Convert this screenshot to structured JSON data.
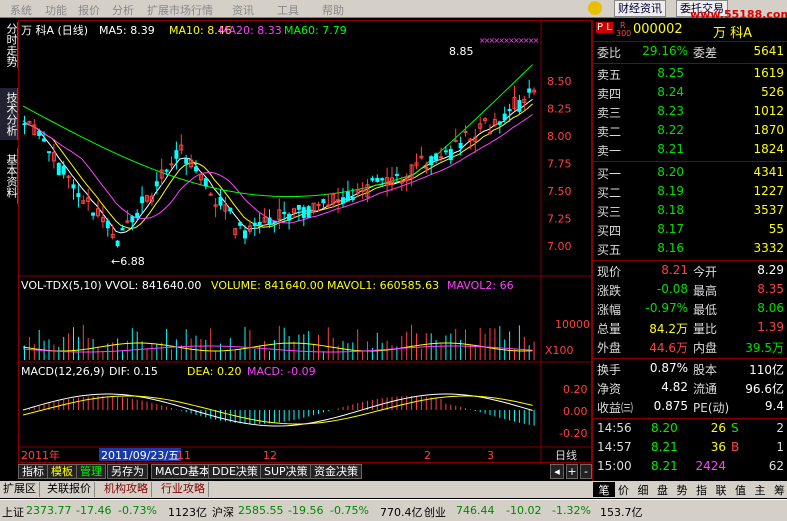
{
  "menu": [
    "系统",
    "功能",
    "报价",
    "分析",
    "扩展市场行情",
    "资讯",
    "工具",
    "帮助"
  ],
  "logos": [
    "财经资讯",
    "委托交易"
  ],
  "watermark": "www.55188.com",
  "side_tabs": [
    "分时走势",
    "技术分析",
    "基本资料"
  ],
  "chart_header": {
    "stock": "万  科A (日线)",
    "ma5": "MA5: 8.39",
    "ma10": "MA10: 8.46",
    "ma20": "MA20: 8.33",
    "ma60": "MA60: 7.79"
  },
  "price_axis": [
    "8.50",
    "8.25",
    "8.00",
    "7.75",
    "7.50",
    "7.25",
    "7.00"
  ],
  "high_label": "8.85",
  "low_label": "←6.88",
  "vol_header": {
    "name": "VOL-TDX(5,10)",
    "vvol": "VVOL: 841640.00",
    "volume": "VOLUME: 841640.00",
    "mavol1": "MAVOL1: 660585.63",
    "mavol2": "MAVOL2: 66"
  },
  "vol_axis": [
    "10000"
  ],
  "vol_unit": "X100",
  "macd_header": {
    "name": "MACD(12,26,9)",
    "dif": "DIF: 0.15",
    "dea": "DEA: 0.20",
    "macd": "MACD: -0.09"
  },
  "macd_axis": [
    "0.20",
    "0.00",
    "-0.20"
  ],
  "time_axis": {
    "year": "2011年",
    "date": "2011/09/23/五",
    "months": [
      "11",
      "12",
      "2",
      "3"
    ],
    "period": "日线"
  },
  "chart_tabs": [
    "指标",
    "模板",
    "管理",
    "另存为",
    "MACD基本",
    "DDE决策",
    "SUP决策",
    "资金决策"
  ],
  "bottom_tabs": [
    "扩展区",
    "关联报价",
    "机构攻略",
    "行业攻略"
  ],
  "quote": {
    "pl": "P L",
    "r": "R",
    "r_code": "300",
    "code": "000002",
    "name": "万  科A",
    "weibi_label": "委比",
    "weibi": "29.16%",
    "weicha_label": "委差",
    "weicha": "5641",
    "asks": [
      {
        "label": "卖五",
        "price": "8.25",
        "vol": "1619"
      },
      {
        "label": "卖四",
        "price": "8.24",
        "vol": "526"
      },
      {
        "label": "卖三",
        "price": "8.23",
        "vol": "1012"
      },
      {
        "label": "卖二",
        "price": "8.22",
        "vol": "1870"
      },
      {
        "label": "卖一",
        "price": "8.21",
        "vol": "1824"
      }
    ],
    "bids": [
      {
        "label": "买一",
        "price": "8.20",
        "vol": "4341"
      },
      {
        "label": "买二",
        "price": "8.19",
        "vol": "1227"
      },
      {
        "label": "买三",
        "price": "8.18",
        "vol": "3537"
      },
      {
        "label": "买四",
        "price": "8.17",
        "vol": "55"
      },
      {
        "label": "买五",
        "price": "8.16",
        "vol": "3332"
      }
    ],
    "stats": [
      {
        "l1": "现价",
        "v1": "8.21",
        "l2": "今开",
        "v2": "8.29"
      },
      {
        "l1": "涨跌",
        "v1": "-0.08",
        "l2": "最高",
        "v2": "8.35"
      },
      {
        "l1": "涨幅",
        "v1": "-0.97%",
        "l2": "最低",
        "v2": "8.06"
      },
      {
        "l1": "总量",
        "v1": "84.2万",
        "l2": "量比",
        "v2": "1.39"
      },
      {
        "l1": "外盘",
        "v1": "44.6万",
        "l2": "内盘",
        "v2": "39.5万"
      }
    ],
    "stats2": [
      {
        "l1": "换手",
        "v1": "0.87%",
        "l2": "股本",
        "v2": "110亿"
      },
      {
        "l1": "净资",
        "v1": "4.82",
        "l2": "流通",
        "v2": "96.6亿"
      },
      {
        "l1": "收益㈢",
        "v1": "0.875",
        "l2": "PE(动)",
        "v2": "9.4"
      }
    ],
    "ticks": [
      {
        "t": "14:56",
        "p": "8.20",
        "v": "26",
        "s": "S",
        "n": "2"
      },
      {
        "t": "14:57",
        "p": "8.21",
        "v": "36",
        "s": "B",
        "n": "1"
      },
      {
        "t": "15:00",
        "p": "8.21",
        "v": "2424",
        "s": "",
        "n": "62"
      }
    ],
    "right_tabs": [
      "笔",
      "价",
      "细",
      "盘",
      "势",
      "指",
      "联",
      "值",
      "主",
      "筹"
    ]
  },
  "status": [
    {
      "name": "上证",
      "val": "2373.77",
      "chg": "-17.46",
      "pct": "-0.73%",
      "amt": "1123亿"
    },
    {
      "name": "沪深",
      "val": "2585.55",
      "chg": "-19.56",
      "pct": "-0.75%",
      "amt": "770.4亿"
    },
    {
      "name": "创业",
      "val": "746.44",
      "chg": "-10.02",
      "pct": "-1.32%",
      "amt": "153.7亿"
    }
  ]
}
